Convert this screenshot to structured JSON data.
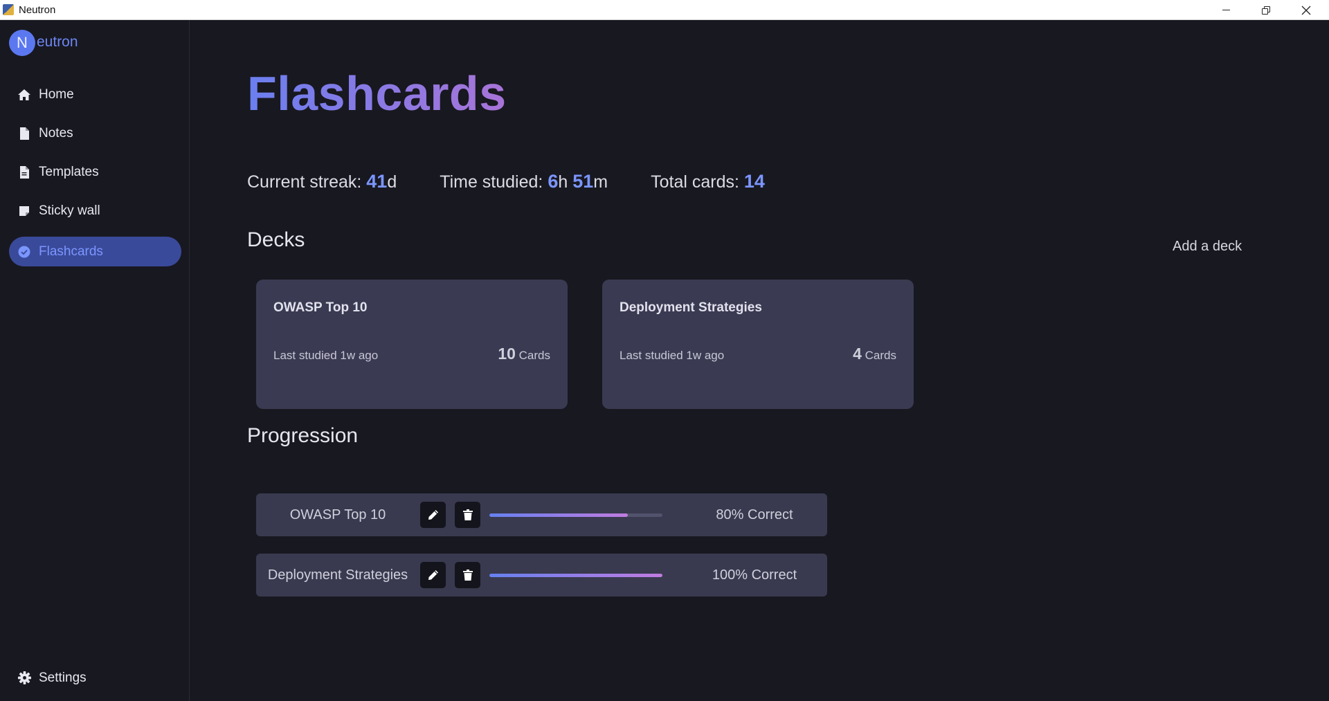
{
  "window": {
    "title": "Neutron"
  },
  "logo": {
    "letter": "N",
    "text": "eutron"
  },
  "sidebar": {
    "items": [
      {
        "label": "Home",
        "icon": "home-icon"
      },
      {
        "label": "Notes",
        "icon": "file-icon"
      },
      {
        "label": "Templates",
        "icon": "file-lines-icon"
      },
      {
        "label": "Sticky wall",
        "icon": "sticky-note-icon"
      },
      {
        "label": "Flashcards",
        "icon": "check-circle-icon",
        "active": true
      }
    ],
    "settings": {
      "label": "Settings",
      "icon": "gear-icon"
    }
  },
  "page": {
    "title": "Flashcards"
  },
  "stats": {
    "streak_label": "Current streak: ",
    "streak_value": "41",
    "streak_unit": "d",
    "time_label": "Time studied: ",
    "time_hours": "6",
    "time_h_unit": "h ",
    "time_minutes": "51",
    "time_m_unit": "m",
    "cards_label": "Total cards: ",
    "cards_value": "14"
  },
  "decks": {
    "heading": "Decks",
    "add_label": "Add a deck",
    "items": [
      {
        "name": "OWASP Top 10",
        "last": "Last studied 1w ago",
        "count": "10",
        "count_unit": " Cards"
      },
      {
        "name": "Deployment Strategies",
        "last": "Last studied 1w ago",
        "count": "4",
        "count_unit": " Cards"
      }
    ]
  },
  "progression": {
    "heading": "Progression",
    "items": [
      {
        "name": "OWASP Top 10",
        "progress": 0.8,
        "label": "80% Correct"
      },
      {
        "name": "Deployment Strategies",
        "progress": 1.0,
        "label": "100% Correct"
      }
    ]
  },
  "colors": {
    "accent": "#7b96ff",
    "background": "#181820",
    "card": "#3a3a52",
    "active_nav": "#3a4a9a"
  }
}
